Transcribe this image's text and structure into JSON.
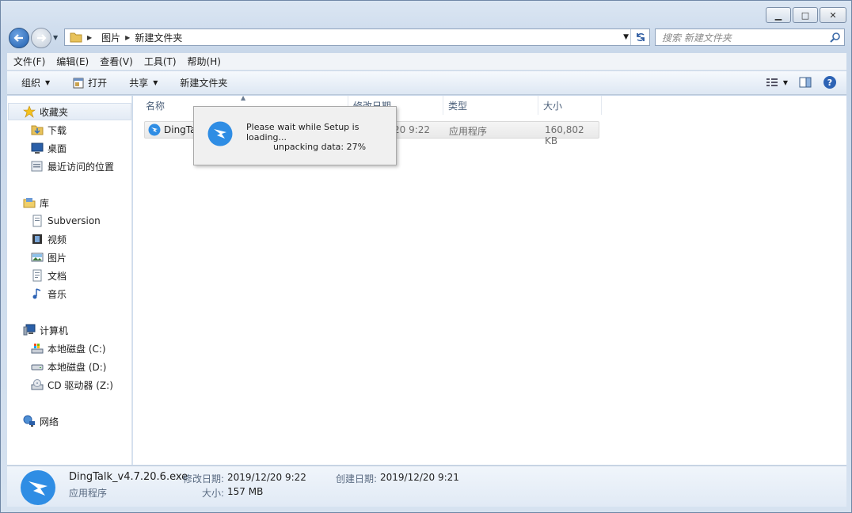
{
  "window": {
    "minimize": "▁",
    "maximize": "□",
    "close": "✕"
  },
  "address": {
    "crumbs": [
      "图片",
      "新建文件夹"
    ],
    "search_placeholder": "搜索 新建文件夹"
  },
  "menu": [
    "文件(F)",
    "编辑(E)",
    "查看(V)",
    "工具(T)",
    "帮助(H)"
  ],
  "commands": {
    "organize": "组织",
    "open": "打开",
    "share": "共享",
    "new_folder": "新建文件夹"
  },
  "sidebar": {
    "favorites": {
      "label": "收藏夹",
      "items": [
        "下载",
        "桌面",
        "最近访问的位置"
      ]
    },
    "libraries": {
      "label": "库",
      "items": [
        "Subversion",
        "视频",
        "图片",
        "文档",
        "音乐"
      ]
    },
    "computer": {
      "label": "计算机",
      "items": [
        "本地磁盘 (C:)",
        "本地磁盘 (D:)",
        "CD 驱动器 (Z:)"
      ]
    },
    "network": {
      "label": "网络"
    }
  },
  "columns": {
    "name": "名称",
    "modified": "修改日期",
    "type": "类型",
    "size": "大小"
  },
  "file": {
    "name": "DingTalk_v4.7.20.6.exe",
    "name_visible": "DingTal",
    "modified_visible": "20 9:22",
    "type": "应用程序",
    "size": "160,802 KB"
  },
  "setup_dialog": {
    "line1": "Please wait while Setup is loading...",
    "line2": "unpacking data: 27%",
    "progress_percent": 27
  },
  "details": {
    "filename": "DingTalk_v4.7.20.6.exe",
    "modified_label": "修改日期:",
    "modified_value": "2019/12/20 9:22",
    "created_label": "创建日期:",
    "created_value": "2019/12/20 9:21",
    "type": "应用程序",
    "size_label": "大小:",
    "size_value": "157 MB"
  },
  "colors": {
    "dingtalk_blue": "#2f8de4",
    "back_button": "#1f5fae"
  }
}
